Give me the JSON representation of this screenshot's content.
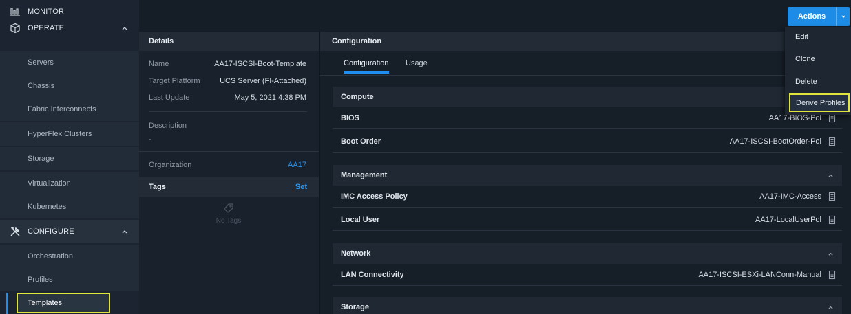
{
  "sidebar": {
    "monitor_label": "MONITOR",
    "operate_label": "OPERATE",
    "operate_items": [
      "Servers",
      "Chassis",
      "Fabric Interconnects",
      "HyperFlex Clusters",
      "Storage",
      "Virtualization",
      "Kubernetes"
    ],
    "configure_label": "CONFIGURE",
    "configure_items": [
      "Orchestration",
      "Profiles",
      "Templates"
    ]
  },
  "actions": {
    "button_label": "Actions",
    "menu": [
      "Edit",
      "Clone",
      "Delete",
      "Derive Profiles"
    ]
  },
  "details": {
    "title": "Details",
    "name_label": "Name",
    "name_value": "AA17-ISCSI-Boot-Template",
    "platform_label": "Target Platform",
    "platform_value": "UCS Server (FI-Attached)",
    "update_label": "Last Update",
    "update_value": "May 5, 2021 4:38 PM",
    "description_label": "Description",
    "description_value": "-",
    "org_label": "Organization",
    "org_value": "AA17",
    "tags_label": "Tags",
    "tags_action": "Set",
    "no_tags": "No Tags"
  },
  "configuration": {
    "title": "Configuration",
    "tabs": [
      "Configuration",
      "Usage"
    ],
    "compute_label": "Compute",
    "bios_label": "BIOS",
    "bios_value": "AA17-BIOS-Pol",
    "boot_label": "Boot Order",
    "boot_value": "AA17-ISCSI-BootOrder-Pol",
    "management_label": "Management",
    "imc_label": "IMC Access Policy",
    "imc_value": "AA17-IMC-Access",
    "local_user_label": "Local User",
    "local_user_value": "AA17-LocalUserPol",
    "network_label": "Network",
    "lan_label": "LAN Connectivity",
    "lan_value": "AA17-ISCSI-ESXi-LANConn-Manual",
    "storage_label": "Storage"
  },
  "colors": {
    "accent": "#1c8ce6",
    "highlight": "#e1e43c",
    "background": "#0f1620"
  }
}
